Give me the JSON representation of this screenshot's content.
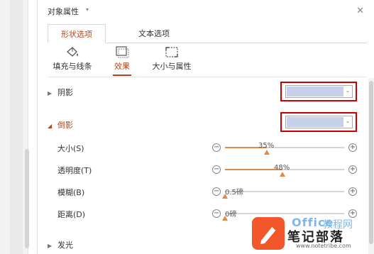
{
  "panel": {
    "title": "对象属性",
    "title_caret": "▾",
    "close_glyph": "✕"
  },
  "tabs": [
    {
      "label": "形状选项",
      "active": true
    },
    {
      "label": "文本选项",
      "active": false
    }
  ],
  "subtabs": [
    {
      "label": "填充与线条",
      "icon": "fill-bucket-icon",
      "active": false
    },
    {
      "label": "效果",
      "icon": "effects-icon",
      "active": true
    },
    {
      "label": "大小与属性",
      "icon": "size-icon",
      "active": false
    }
  ],
  "sections": {
    "shadow": {
      "label": "阴影",
      "arrow": "▶"
    },
    "reflection": {
      "label": "倒影",
      "arrow": "◢"
    },
    "glow": {
      "label": "发光",
      "arrow": "▶"
    }
  },
  "reflection_rows": [
    {
      "label": "大小(S)",
      "value_text": "35%",
      "percent": 35
    },
    {
      "label": "透明度(T)",
      "value_text": "48%",
      "percent": 48
    },
    {
      "label": "模糊(B)",
      "value_text": "0.5磅",
      "percent": 0
    },
    {
      "label": "距离(D)",
      "value_text": "0磅",
      "percent": 0
    }
  ],
  "buttons": {
    "minus": "−",
    "plus": "+"
  },
  "dropdown_caret": "⌄",
  "colors": {
    "accent": "#b1461f",
    "highlight": "#cc0000",
    "swatch": "#c6d0e8",
    "slider": "#e08a4a"
  },
  "watermark": {
    "brand_top": "Office",
    "brand_suffix": "教程网",
    "brand_main": "笔记部落",
    "url": "www.notetribe.com"
  }
}
